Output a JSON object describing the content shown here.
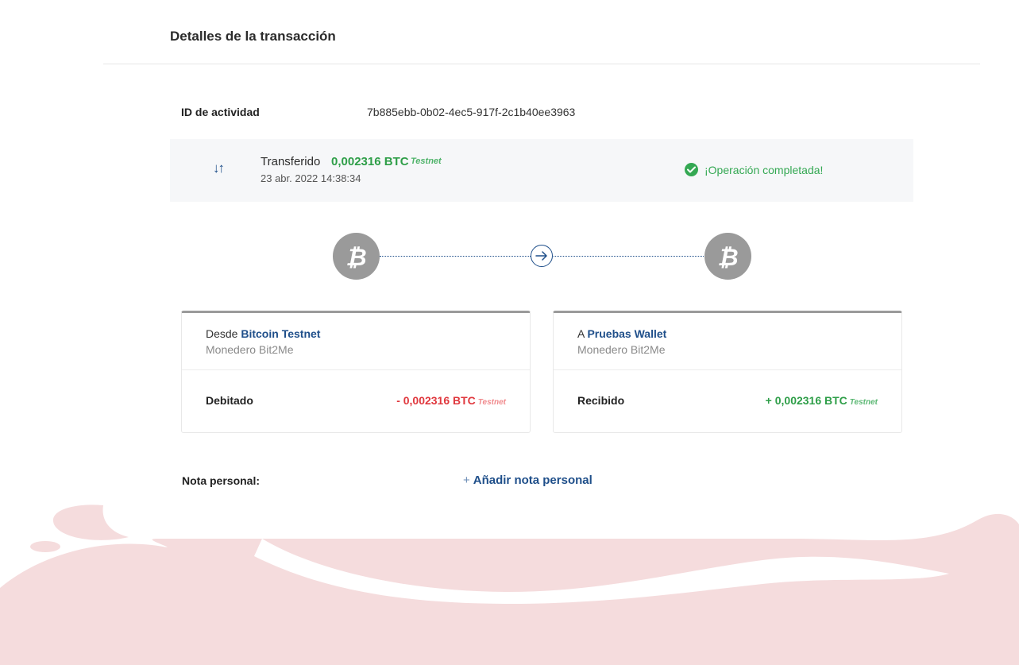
{
  "header": {
    "title": "Detalles de la transacción"
  },
  "activity": {
    "label": "ID de actividad",
    "value": "7b885ebb-0b02-4ec5-917f-2c1b40ee3963"
  },
  "summary": {
    "action": "Transferido",
    "amount": "0,002316 BTC",
    "network": "Testnet",
    "date": "23 abr. 2022 14:38:34",
    "status": "¡Operación completada!",
    "status_color": "#34a853",
    "icon": "transfer-arrows-icon"
  },
  "flow": {
    "from_icon": "bitcoin-icon",
    "arrow_icon": "arrow-right-icon",
    "to_icon": "bitcoin-icon"
  },
  "from_card": {
    "prefix": "Desde",
    "name": "Bitcoin Testnet",
    "subtitle": "Monedero Bit2Me",
    "row_label": "Debitado",
    "amount": "- 0,002316 BTC",
    "network": "Testnet",
    "amount_color": "#e0383e"
  },
  "to_card": {
    "prefix": "A",
    "name": "Pruebas Wallet",
    "subtitle": "Monedero Bit2Me",
    "row_label": "Recibido",
    "amount": "+ 0,002316 BTC",
    "network": "Testnet",
    "amount_color": "#2e9e48"
  },
  "note": {
    "label": "Nota personal:",
    "plus": "+",
    "add_label": "Añadir nota personal"
  },
  "colors": {
    "accent": "#1f4f8a",
    "blob": "#f5dcdd",
    "coin": "#9a9a9a"
  }
}
